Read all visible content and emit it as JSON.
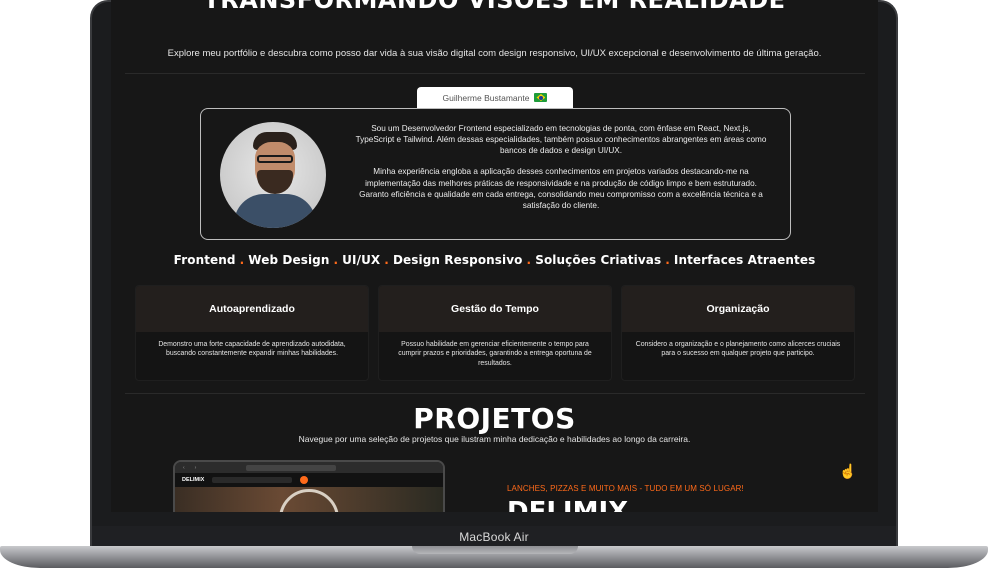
{
  "hero": {
    "title": "TRANSFORMANDO VISÕES EM REALIDADE",
    "subtitle": "Explore meu portfólio e descubra como posso dar vida à sua visão digital com design responsivo, UI/UX excepcional e desenvolvimento de última geração."
  },
  "profile": {
    "name": "Guilherme Bustamante",
    "flag_icon": "brazil-flag-icon",
    "paragraph1": "Sou um Desenvolvedor Frontend especializado em tecnologias de ponta, com ênfase em React, Next.js, TypeScript e Tailwind. Além dessas especialidades, também possuo conhecimentos abrangentes em áreas como bancos de dados e design UI/UX.",
    "paragraph2": "Minha experiência engloba a aplicação desses conhecimentos em projetos variados destacando-me na implementação das melhores práticas de responsividade e na produção de código limpo e bem estruturado. Garanto eficiência e qualidade em cada entrega, consolidando meu compromisso com a excelência técnica e a satisfação do cliente."
  },
  "skills": [
    "Frontend",
    "Web Design",
    "UI/UX",
    "Design Responsivo",
    "Soluções Criativas",
    "Interfaces Atraentes"
  ],
  "features": [
    {
      "title": "Autoaprendizado",
      "text": "Demonstro uma forte capacidade de aprendizado autodidata, buscando constantemente expandir minhas habilidades."
    },
    {
      "title": "Gestão do Tempo",
      "text": "Possuo habilidade em gerenciar eficientemente o tempo para cumprir prazos e prioridades, garantindo a entrega oportuna de resultados."
    },
    {
      "title": "Organização",
      "text": "Considero a organização e o planejamento como alicerces cruciais para o sucesso em qualquer projeto que participo."
    }
  ],
  "projects": {
    "title": "PROJETOS",
    "subtitle": "Navegue por uma seleção de projetos que ilustram minha dedicação e habilidades ao longo da carreira.",
    "featured": {
      "tagline": "LANCHES, PIZZAS E MUITO MAIS - TUDO EM UM SÓ LUGAR!",
      "name": "DELIMIX",
      "mock_brand": "DELIMIX"
    }
  },
  "device": {
    "label": "MacBook Air"
  },
  "colors": {
    "accent": "#ff6a1a",
    "background": "#171717",
    "card_header": "#231f1d"
  }
}
